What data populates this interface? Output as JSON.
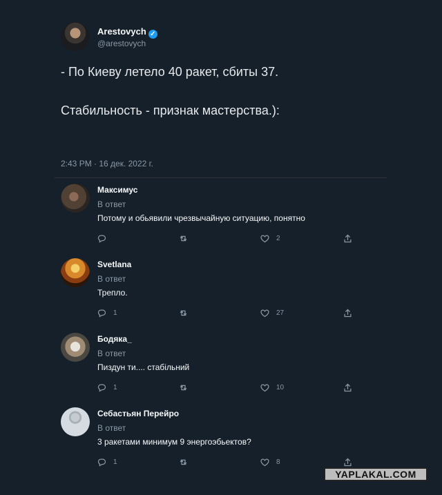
{
  "tweet": {
    "author_name": "Arestovych",
    "author_handle": "@arestovych",
    "text_line1": "- По Киеву летело 40 ракет, сбиты 37.",
    "text_line2": "Стабильность - признак мастерства.):",
    "timestamp": "2:43 PM · 16 дек. 2022 г."
  },
  "replies": [
    {
      "name": "Максимус",
      "meta": "В ответ",
      "text": "Потому и обьявили чрезвычайную ситуацию, понятно",
      "reply_count": "",
      "retweet_count": "",
      "like_count": "2"
    },
    {
      "name": "Svetlana",
      "meta": "В ответ",
      "text": "Трепло.",
      "reply_count": "1",
      "retweet_count": "",
      "like_count": "27"
    },
    {
      "name": "Бодяка_",
      "meta": "В ответ",
      "text": "Пиздун ти.... стабільний",
      "reply_count": "1",
      "retweet_count": "",
      "like_count": "10"
    },
    {
      "name": "Себастьян Перейро",
      "meta": "В ответ",
      "text": "3 ракетами минимум 9 энергоэбьектов?",
      "reply_count": "1",
      "retweet_count": "",
      "like_count": "8"
    }
  ],
  "colors": {
    "background": "#15202b",
    "muted": "#8b98a5",
    "verified": "#1d9bf0"
  },
  "icons": [
    "verified-icon",
    "reply-icon",
    "retweet-icon",
    "like-icon",
    "share-icon"
  ],
  "watermark": "YAPLAKAL.COM"
}
